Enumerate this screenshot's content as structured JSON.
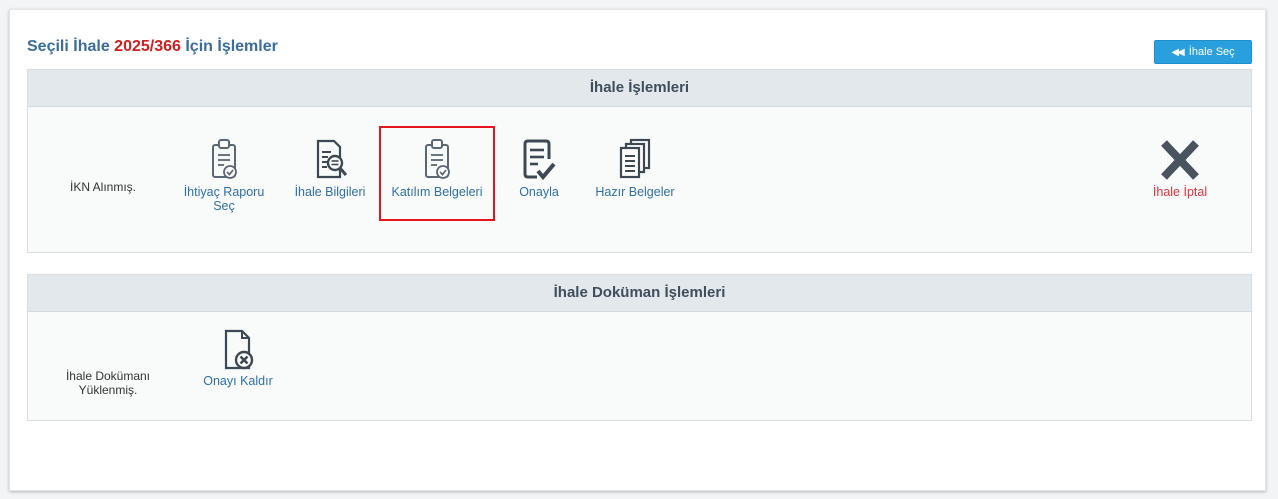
{
  "header": {
    "title_prefix": "Seçili İhale",
    "tender_number": "2025/366",
    "title_suffix": "İçin İşlemler",
    "back_button_icon": "double-chevron-left-icon",
    "back_button_label": "İhale Seç"
  },
  "tender_panel": {
    "title": "İhale İşlemleri",
    "status": "İKN Alınmış.",
    "actions": [
      {
        "icon": "clipboard-check-icon",
        "label": "İhtiyaç Raporu Seç",
        "line1": "İhtiyaç Raporu",
        "line2": "Seç"
      },
      {
        "icon": "document-search-icon",
        "label": "İhale Bilgileri"
      },
      {
        "icon": "clipboard-check-icon",
        "label": "Katılım Belgeleri",
        "highlighted": true
      },
      {
        "icon": "document-approve-icon",
        "label": "Onayla"
      },
      {
        "icon": "documents-stack-icon",
        "label": "Hazır Belgeler"
      }
    ],
    "cancel": {
      "icon": "x-icon",
      "label": "İhale İptal",
      "color": "#d9363e"
    }
  },
  "document_panel": {
    "title": "İhale Doküman İşlemleri",
    "status_line1": "İhale Dokümanı",
    "status_line2": "Yüklenmiş.",
    "actions": [
      {
        "icon": "document-remove-icon",
        "label": "Onayı Kaldır"
      }
    ]
  },
  "colors": {
    "title_blue": "#3a6c9d",
    "tender_number_red": "#cc1f1f",
    "button_blue": "#29a0dd",
    "link_blue": "#2f6fa8",
    "highlight_red": "#e6151d"
  }
}
